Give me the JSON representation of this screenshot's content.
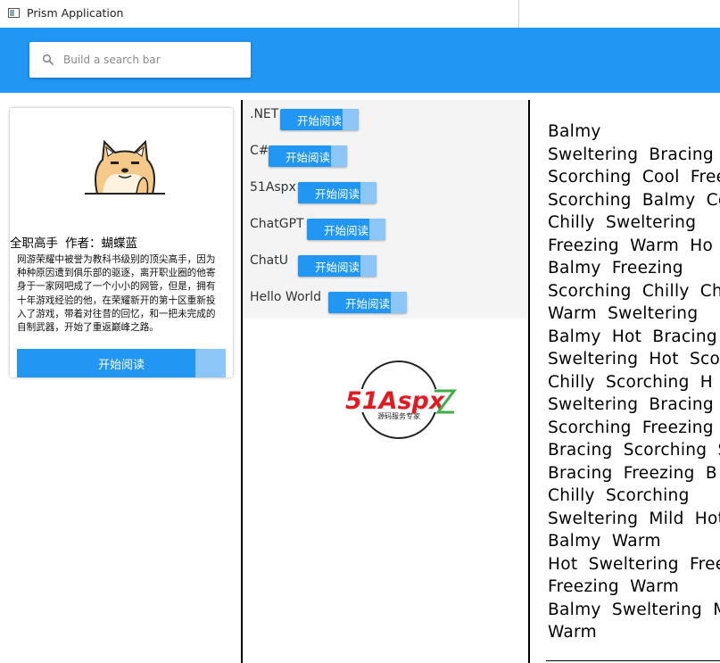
{
  "window": {
    "title": "Prism Application"
  },
  "search": {
    "placeholder": "Build a search bar",
    "value": ""
  },
  "book_card": {
    "title": "全职高手",
    "author": "作者：蝴蝶蓝",
    "description": "网游荣耀中被誉为教科书级别的顶尖高手，因为种种原因遭到俱乐部的驱逐，离开职业圈的他寄身于一家网吧成了一个小小的网管，但是，拥有十年游戏经验的他，在荣耀新开的第十区重新投入了游戏，带着对往昔的回忆，和一把未完成的自制武器，开始了重返巅峰之路。",
    "read_label": "开始阅读"
  },
  "list": {
    "items": [
      {
        "name": ".NET",
        "read_label": "开始阅读"
      },
      {
        "name": "C#",
        "read_label": "开始阅读"
      },
      {
        "name": "51Aspx",
        "read_label": "开始阅读"
      },
      {
        "name": "ChatGPT",
        "read_label": "开始阅读"
      },
      {
        "name": "ChatU",
        "read_label": "开始阅读"
      },
      {
        "name": "Hello World",
        "read_label": "开始阅读"
      }
    ]
  },
  "logo": {
    "text": "51Aspx",
    "subtitle": "源码服务专家"
  },
  "words": [
    "Balmy",
    "Sweltering Bracing",
    "Scorching Cool Free",
    "Scorching Balmy Co",
    "Chilly Sweltering",
    "Freezing Warm Ho",
    "Balmy Freezing",
    "Scorching Chilly Ch",
    "Warm Sweltering",
    "Balmy Hot Bracing",
    "Sweltering Hot Scor",
    "Chilly Scorching H",
    "Sweltering Bracing",
    "Scorching Freezing",
    "Bracing Scorching Sv",
    "Bracing Freezing B",
    "Chilly Scorching",
    "Sweltering Mild Hot",
    "Balmy Warm",
    "Hot Sweltering Free",
    "Freezing Warm",
    "Balmy Sweltering M",
    "Warm"
  ],
  "colors": {
    "accent": "#2196F3",
    "button_tail": "#8CC6F7",
    "logo_red": "#E21B23",
    "logo_green": "#3DAE49"
  }
}
